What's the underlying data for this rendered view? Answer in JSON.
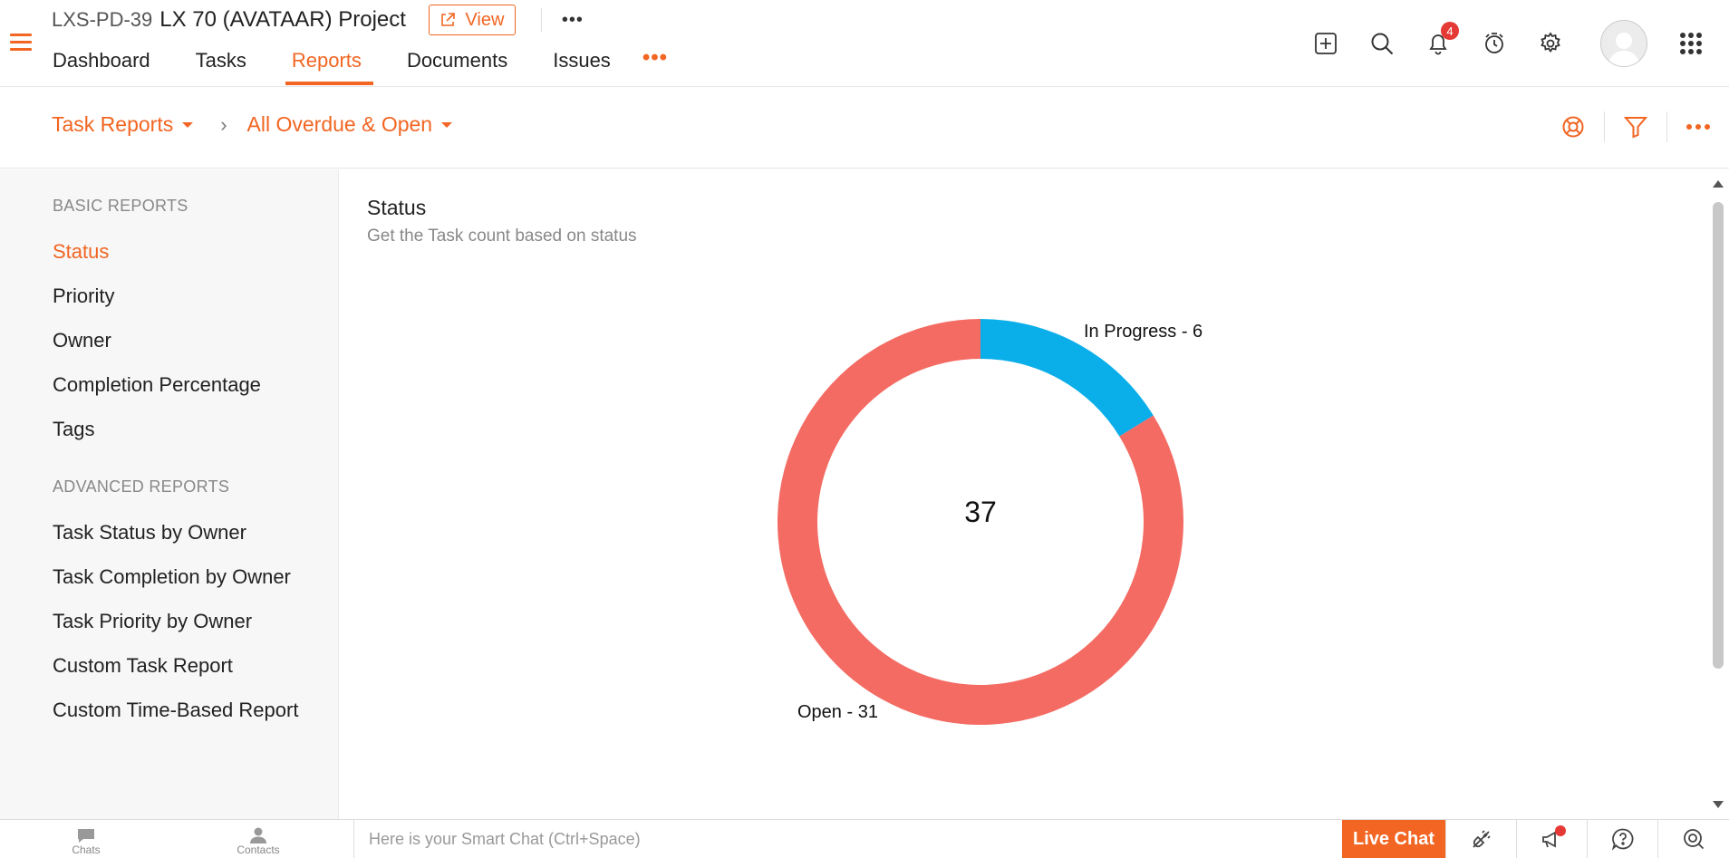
{
  "project": {
    "id": "LXS-PD-39",
    "name": "LX 70 (AVATAAR) Project",
    "view_label": "View",
    "more_label": "•••"
  },
  "nav": {
    "tabs": [
      {
        "label": "Dashboard"
      },
      {
        "label": "Tasks"
      },
      {
        "label": "Reports",
        "active": true
      },
      {
        "label": "Documents"
      },
      {
        "label": "Issues"
      }
    ],
    "more_label": "•••"
  },
  "header_icons": {
    "notification_count": "4",
    "icons": [
      "add-icon",
      "search-icon",
      "bell-icon",
      "timer-icon",
      "gear-icon",
      "avatar",
      "apps-grid-icon"
    ]
  },
  "breadcrumb": {
    "report_type": "Task Reports",
    "filter": "All Overdue & Open"
  },
  "sidebar": {
    "basic_heading": "BASIC REPORTS",
    "basic_items": [
      "Status",
      "Priority",
      "Owner",
      "Completion Percentage",
      "Tags"
    ],
    "active_item": "Status",
    "advanced_heading": "ADVANCED REPORTS",
    "advanced_items": [
      "Task Status by Owner",
      "Task Completion by Owner",
      "Task Priority by Owner",
      "Custom Task Report",
      "Custom Time-Based Report"
    ]
  },
  "report": {
    "title": "Status",
    "subtitle": "Get the Task count based on status"
  },
  "chart_data": {
    "type": "pie",
    "variant": "donut",
    "total_label": "37",
    "slices": [
      {
        "name": "In Progress",
        "value": 6,
        "label": "In Progress - 6",
        "color": "#0aaee9"
      },
      {
        "name": "Open",
        "value": 31,
        "label": "Open - 31",
        "color": "#f46b63"
      }
    ]
  },
  "footer": {
    "chats_label": "Chats",
    "contacts_label": "Contacts",
    "smart_chat_placeholder": "Here is your Smart Chat (Ctrl+Space)",
    "live_chat_label": "Live Chat"
  },
  "colors": {
    "accent": "#f26522",
    "badge": "#e53935"
  }
}
